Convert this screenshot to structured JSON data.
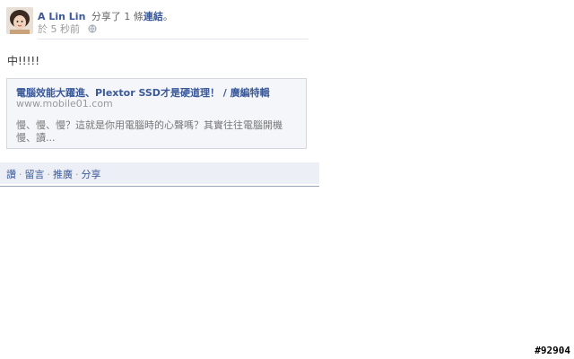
{
  "post": {
    "author": "A Lin Lin",
    "action": "分享了 1 條",
    "action_link": "連結",
    "action_end": "。",
    "timestamp": "於 5 秒前",
    "message": "中!!!!!"
  },
  "attachment": {
    "title": "電腦效能大躍進、Plextor SSD才是硬道理！ / 廣編特輯",
    "url": "www.mobile01.com",
    "description": "慢、慢、慢？這就是你用電腦時的心聲嗎？其實往往電腦開機慢、讀..."
  },
  "actions": {
    "read": "讚",
    "comment": "留言",
    "promote": "推廣",
    "share": "分享",
    "separator": "·"
  },
  "watermark": "#92904",
  "colors": {
    "link": "#3b5998",
    "action_bar": "#eceff5",
    "muted": "#999999"
  }
}
